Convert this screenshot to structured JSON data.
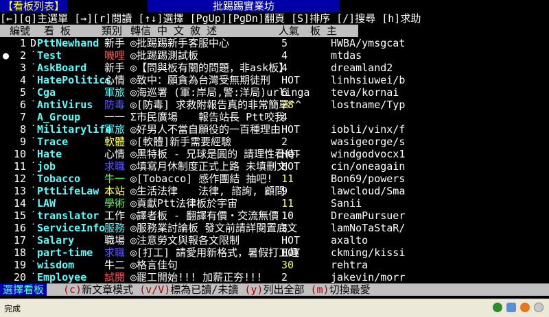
{
  "title": {
    "mode_label": "【看板列表】",
    "board_name": "批踢踢實業坊"
  },
  "help_line": "[←][q]主選單 [→][r]閱讀 [↑↓]選擇 [PgUp][PgDn]翻頁 [S]排序 [/]搜尋 [h]求助",
  "header": {
    "num": "編號",
    "board": "看 板",
    "category": "類別",
    "title": "轉信 中 文 敘 述",
    "popularity": "人氣",
    "mods": "板 主"
  },
  "rows": [
    {
      "num": "1",
      "mark": "D",
      "name": "PttNewhand",
      "cat": "新手",
      "title": "◎批踢踢新手客服中心",
      "pop": "5",
      "mods": "HWBA/ymsgcat",
      "cat_color": "#ffffff",
      "pop_color": "#ffffff"
    },
    {
      "num": "2",
      "mark": "˙",
      "name": "Test",
      "cat": "嘰哩",
      "title": "◎批踢踢測試板",
      "pop": "4",
      "mods": "mtdas",
      "cat_color": "#ff5555",
      "pop_color": "#ffffff"
    },
    {
      "num": "3",
      "mark": "˙",
      "name": "AskBoard",
      "cat": "新手",
      "title": "◎【問與板有關的問題，非ask板】",
      "pop": "4",
      "mods": "dreamland2",
      "cat_color": "#ffffff",
      "pop_color": "#ffffff"
    },
    {
      "num": "4",
      "mark": "˙",
      "name": "HatePolitics",
      "cat": "心情",
      "title": "◎致中：願貪為台灣受無期徒刑",
      "pop": "HOT",
      "mods": "linhsiuwei/b",
      "cat_color": "#ffffff",
      "pop_color": "#ffffff"
    },
    {
      "num": "5",
      "mark": "˙",
      "name": "Cga",
      "cat": "軍旅",
      "title": "◎海巡署 (軍:岸局,警:洋局)urlinga",
      "pop": "6",
      "mods": "teva/kornai",
      "cat_color": "#55ffff",
      "pop_color": "#ffffff"
    },
    {
      "num": "6",
      "mark": "˙",
      "name": "AntiVirus",
      "cat": "防毒",
      "title": "◎[防毒] 求救附報告真的非常簡單^^",
      "pop": "28",
      "mods": "lostname/Typ",
      "cat_color": "#5555ff",
      "pop_color": "#ffff55"
    },
    {
      "num": "7",
      "mark": "",
      "name": "A_Group",
      "cat": "一一",
      "title": "Σ市民廣場　　報告站長 Ptt咬我",
      "pop": "4",
      "mods": "",
      "cat_color": "#ffffff",
      "pop_color": "#ffffff"
    },
    {
      "num": "8",
      "mark": "˙",
      "name": "Militarylife",
      "cat": "軍旅",
      "title": "◎好男人不當自願役的一百種理由",
      "pop": "HOT",
      "mods": "iobli/vinx/f",
      "cat_color": "#55ffff",
      "pop_color": "#ffffff"
    },
    {
      "num": "9",
      "mark": "˙",
      "name": "Trace",
      "cat": "軟體",
      "title": "◎[軟體]新手需要經驗",
      "pop": "2",
      "mods": "wasigeorge/s",
      "cat_color": "#ffff55",
      "pop_color": "#ffffff"
    },
    {
      "num": "10",
      "mark": "˙",
      "name": "Hate",
      "cat": "心情",
      "title": "◎黑特板 - 兄球是圓的 請理性看待-",
      "pop": "HOT",
      "mods": "windgodvocx1",
      "cat_color": "#ffffff",
      "pop_color": "#ffffff"
    },
    {
      "num": "11",
      "mark": "˙",
      "name": "job",
      "cat": "求職",
      "title": "◎填寫月休制度正式上路 未填刪文",
      "pop": "HOT",
      "mods": "cin/oneagain",
      "cat_color": "#5555ff",
      "pop_color": "#ffffff"
    },
    {
      "num": "12",
      "mark": "˙",
      "name": "Tobacco",
      "cat": "牛一",
      "title": "◎[Tobacco] 感作團結 抽吧!",
      "pop": "11",
      "mods": "Bon69/powers",
      "cat_color": "#55ff55",
      "pop_color": "#ffff55"
    },
    {
      "num": "13",
      "mark": "˙",
      "name": "PttLifeLaw",
      "cat": "本站",
      "title": "◎生活法律　　法律, 諮詢, 顧問",
      "pop": "9",
      "mods": "lawcloud/Sma",
      "cat_color": "#ffff55",
      "pop_color": "#ffffff"
    },
    {
      "num": "14",
      "mark": "˙",
      "name": "LAW",
      "cat": "學術",
      "title": "◎貢獻Ptt法律板於宇宙",
      "pop": "11",
      "mods": "Sanii",
      "cat_color": "#55ff55",
      "pop_color": "#ffff55"
    },
    {
      "num": "15",
      "mark": "˙",
      "name": "translator",
      "cat": "工作",
      "title": "◎譯者板 - 翻譯有價‧交流無價",
      "pop": "10",
      "mods": "DreamPursuer",
      "cat_color": "#ffffff",
      "pop_color": "#ffffff"
    },
    {
      "num": "16",
      "mark": "˙",
      "name": "ServiceInfo",
      "cat": "服務",
      "title": "◎服務業討論板 發文前請詳閱置底文",
      "pop": "3",
      "mods": "lamNoTaStaR/",
      "cat_color": "#55ffff",
      "pop_color": "#ffffff"
    },
    {
      "num": "17",
      "mark": "˙",
      "name": "Salary",
      "cat": "職場",
      "title": "◎注意勞文與報各文限制",
      "pop": "HOT",
      "mods": "axalto",
      "cat_color": "#ffffff",
      "pop_color": "#ffffff"
    },
    {
      "num": "18",
      "mark": "˙",
      "name": "part-time",
      "cat": "求職",
      "title": "◎[打工] 請愛用新格式，暑假打工趣",
      "pop": "HOT",
      "mods": "ckming/kissi",
      "cat_color": "#5555ff",
      "pop_color": "#ffffff"
    },
    {
      "num": "19",
      "mark": "˙",
      "name": "wisdom",
      "cat": "牛二",
      "title": "◎格言佳句",
      "pop": "30",
      "mods": "rehtra",
      "cat_color": "#ffffff",
      "pop_color": "#ffff55"
    },
    {
      "num": "20",
      "mark": "˙",
      "name": "Employee",
      "cat": "試閱",
      "title": "◎罷工開始!!! 加薪正夯!!!",
      "pop": "2",
      "mods": "jakevin/morr",
      "cat_color": "#ff5555",
      "pop_color": "#ffffff"
    }
  ],
  "cursor_glyph": "●",
  "footer": {
    "label": "選擇看板",
    "hints": [
      {
        "key": "(c)",
        "text": "新文章模式"
      },
      {
        "key": "(v/V)",
        "text": "標為已讀/未讀"
      },
      {
        "key": "(y)",
        "text": "列出全部"
      },
      {
        "key": "(m)",
        "text": "切換最愛"
      }
    ]
  },
  "statusbar": {
    "text": "完成",
    "icons": [
      "m-icon",
      "shield-icon",
      "firefox-icon",
      "globe-icon"
    ]
  },
  "colors": {
    "title_bg": "#0000a8",
    "header_bg": "#c0c0c0",
    "board_name": "#55ffff",
    "highlight": "#ffff55"
  }
}
